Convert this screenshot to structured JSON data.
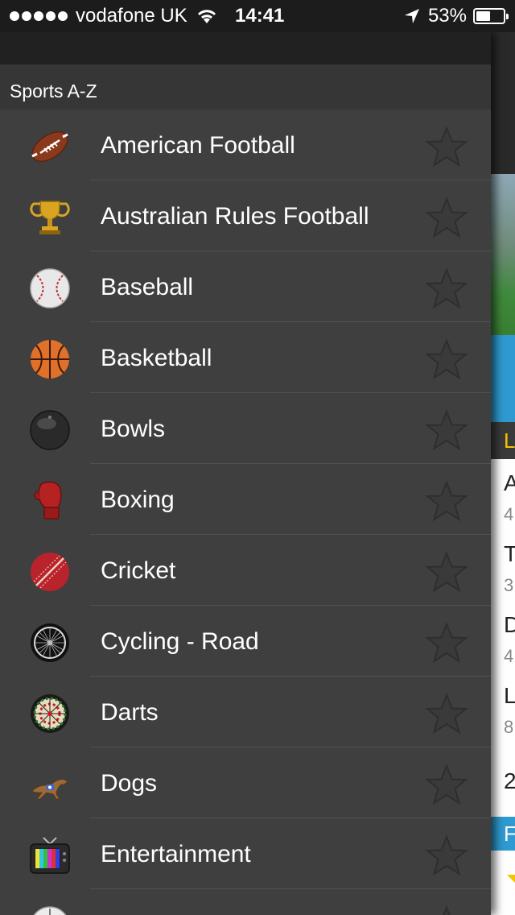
{
  "status_bar": {
    "carrier": "vodafone UK",
    "time": "14:41",
    "battery_percent_label": "53%",
    "battery_level": 0.53,
    "signal_dots": 5
  },
  "drawer": {
    "section_title": "Sports A-Z",
    "sports": [
      {
        "label": "American Football",
        "icon": "american-football-icon"
      },
      {
        "label": "Australian Rules Football",
        "icon": "trophy-icon"
      },
      {
        "label": "Baseball",
        "icon": "baseball-icon"
      },
      {
        "label": "Basketball",
        "icon": "basketball-icon"
      },
      {
        "label": "Bowls",
        "icon": "bowls-icon"
      },
      {
        "label": "Boxing",
        "icon": "boxing-glove-icon"
      },
      {
        "label": "Cricket",
        "icon": "cricket-ball-icon"
      },
      {
        "label": "Cycling - Road",
        "icon": "bicycle-wheel-icon"
      },
      {
        "label": "Darts",
        "icon": "dartboard-icon"
      },
      {
        "label": "Dogs",
        "icon": "greyhound-icon"
      },
      {
        "label": "Entertainment",
        "icon": "television-icon"
      },
      {
        "label": "",
        "icon": "football-icon"
      }
    ]
  },
  "background": {
    "section_letter": "L",
    "list_letters": [
      "A",
      "4",
      "T",
      "3",
      "D",
      "4",
      "L",
      "8",
      "2"
    ],
    "blue_section_letter": "F"
  },
  "colors": {
    "drawer_bg": "#3f3f3f",
    "section_header_bg": "#363636",
    "status_bar_bg": "#1c1c1c",
    "accent_blue": "#2f9ad1",
    "accent_yellow": "#f5c400",
    "star_outline": "#333333"
  }
}
